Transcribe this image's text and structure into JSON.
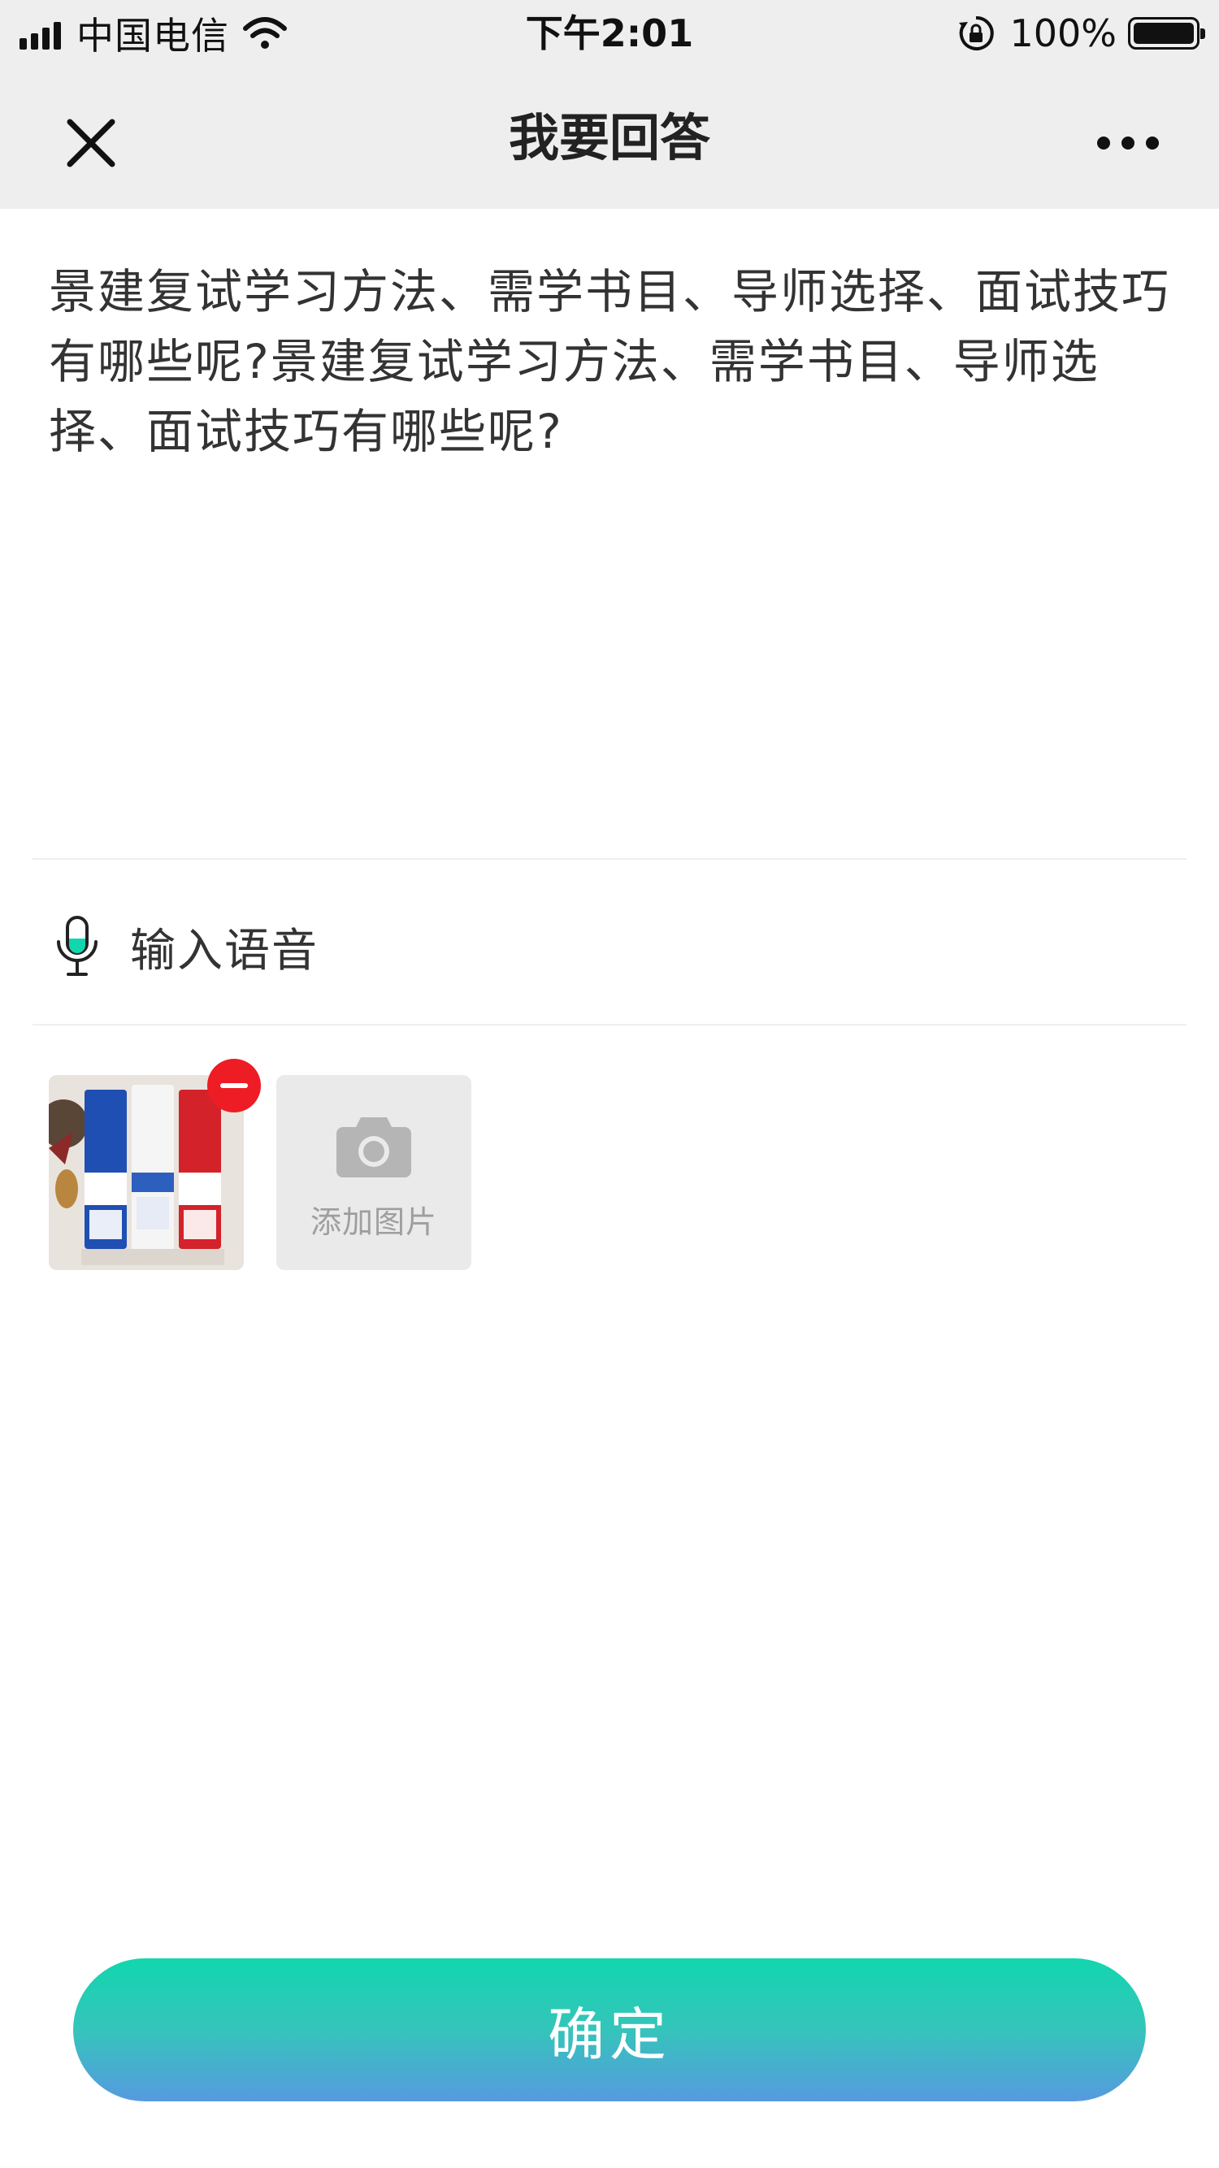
{
  "status_bar": {
    "carrier": "中国电信",
    "time": "下午2:01",
    "battery": "100%"
  },
  "nav": {
    "title": "我要回答"
  },
  "question": {
    "text": "景建复试学习方法、需学书目、导师选择、面试技巧有哪些呢?景建复试学习方法、需学书目、导师选择、面试技巧有哪些呢?"
  },
  "voice": {
    "label": "输入语音"
  },
  "images": {
    "add_label": "添加图片"
  },
  "confirm": {
    "label": "确定"
  },
  "colors": {
    "accent_top": "#12d6ae",
    "accent_bottom": "#569ae0",
    "remove": "#ee1c25",
    "mic_fill": "#12d6ae"
  },
  "icons": [
    "signal-icon",
    "wifi-icon",
    "rotation-lock-icon",
    "battery-icon",
    "close-icon",
    "more-icon",
    "microphone-icon",
    "remove-icon",
    "camera-icon"
  ]
}
